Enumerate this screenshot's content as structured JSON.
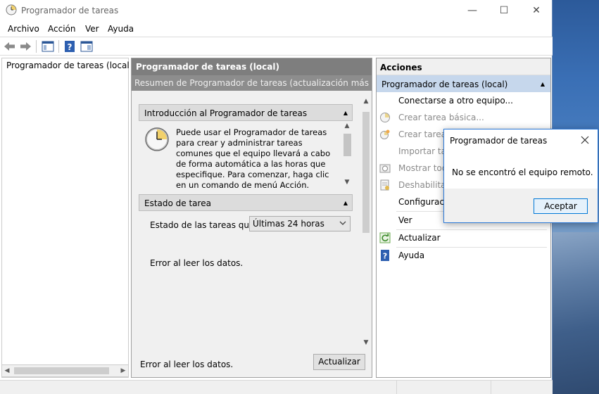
{
  "window": {
    "title": "Programador de tareas",
    "controls": {
      "minimize": "—",
      "maximize": "☐",
      "close": "✕"
    }
  },
  "menu": {
    "items": [
      "Archivo",
      "Acción",
      "Ver",
      "Ayuda"
    ]
  },
  "tree": {
    "root_label": "Programador de tareas (local"
  },
  "center": {
    "header": "Programador de tareas (local)",
    "subheader": "Resumen de Programador de tareas (actualización más reciente:",
    "intro": {
      "title": "Introducción al Programador de tareas",
      "text": "Puede usar el Programador de tareas para crear y administrar tareas comunes que el equipo llevará a cabo de forma automática a las horas que especifique. Para comenzar, haga clic en un comando de menú Acción."
    },
    "status": {
      "title": "Estado de tarea",
      "label": "Estado de las tareas qu...",
      "dropdown_value": "Últimas 24 horas",
      "error": "Error al leer los datos."
    },
    "footer": {
      "error": "Error al leer los datos.",
      "refresh_button": "Actualizar"
    }
  },
  "actions": {
    "header": "Acciones",
    "group": "Programador de tareas (local)",
    "items": [
      {
        "label": "Conectarse a otro equipo...",
        "enabled": true
      },
      {
        "label": "Crear tarea básica...",
        "enabled": false
      },
      {
        "label": "Crear tarea...",
        "enabled": false
      },
      {
        "label": "Importar tar",
        "enabled": false
      },
      {
        "label": "Mostrar toda",
        "enabled": false
      },
      {
        "label": "Deshabilitar",
        "enabled": false
      },
      {
        "label": "Configuració",
        "enabled": true
      },
      {
        "label": "Ver",
        "enabled": true
      },
      {
        "label": "Actualizar",
        "enabled": true
      },
      {
        "label": "Ayuda",
        "enabled": true
      }
    ]
  },
  "dialog": {
    "title": "Programador de tareas",
    "message": "No se encontró el equipo remoto.",
    "ok_button": "Aceptar"
  },
  "colors": {
    "accent": "#0078d7",
    "center_header": "#7e7e7e",
    "actions_group": "#c6d7ec"
  }
}
